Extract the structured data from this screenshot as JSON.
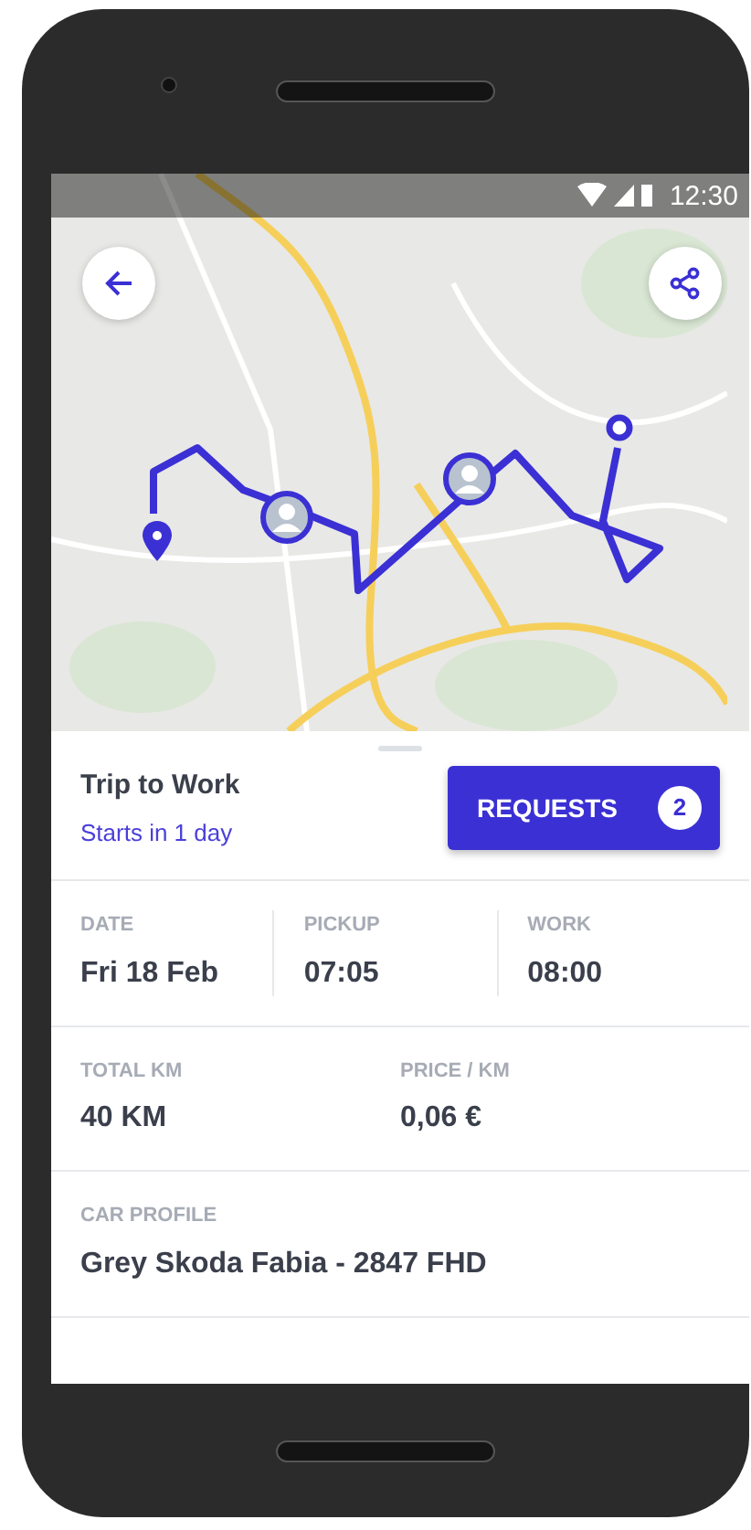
{
  "status_bar": {
    "time": "12:30"
  },
  "trip": {
    "title": "Trip to Work",
    "subtitle": "Starts in 1 day"
  },
  "requests_button": {
    "label": "REQUESTS",
    "count": "2"
  },
  "detail_rows": [
    {
      "divided": true,
      "fields": [
        {
          "label": "DATE",
          "value": "Fri 18 Feb"
        },
        {
          "label": "PICKUP",
          "value": "07:05"
        },
        {
          "label": "WORK",
          "value": "08:00"
        }
      ]
    },
    {
      "divided": false,
      "fields": [
        {
          "label": "TOTAL KM",
          "value": "40 KM"
        },
        {
          "label": "PRICE / KM",
          "value": "0,06 €"
        }
      ]
    },
    {
      "fields": [
        {
          "label": "CAR PROFILE",
          "value": "Grey Skoda Fabia - 2847 FHD"
        }
      ]
    }
  ]
}
